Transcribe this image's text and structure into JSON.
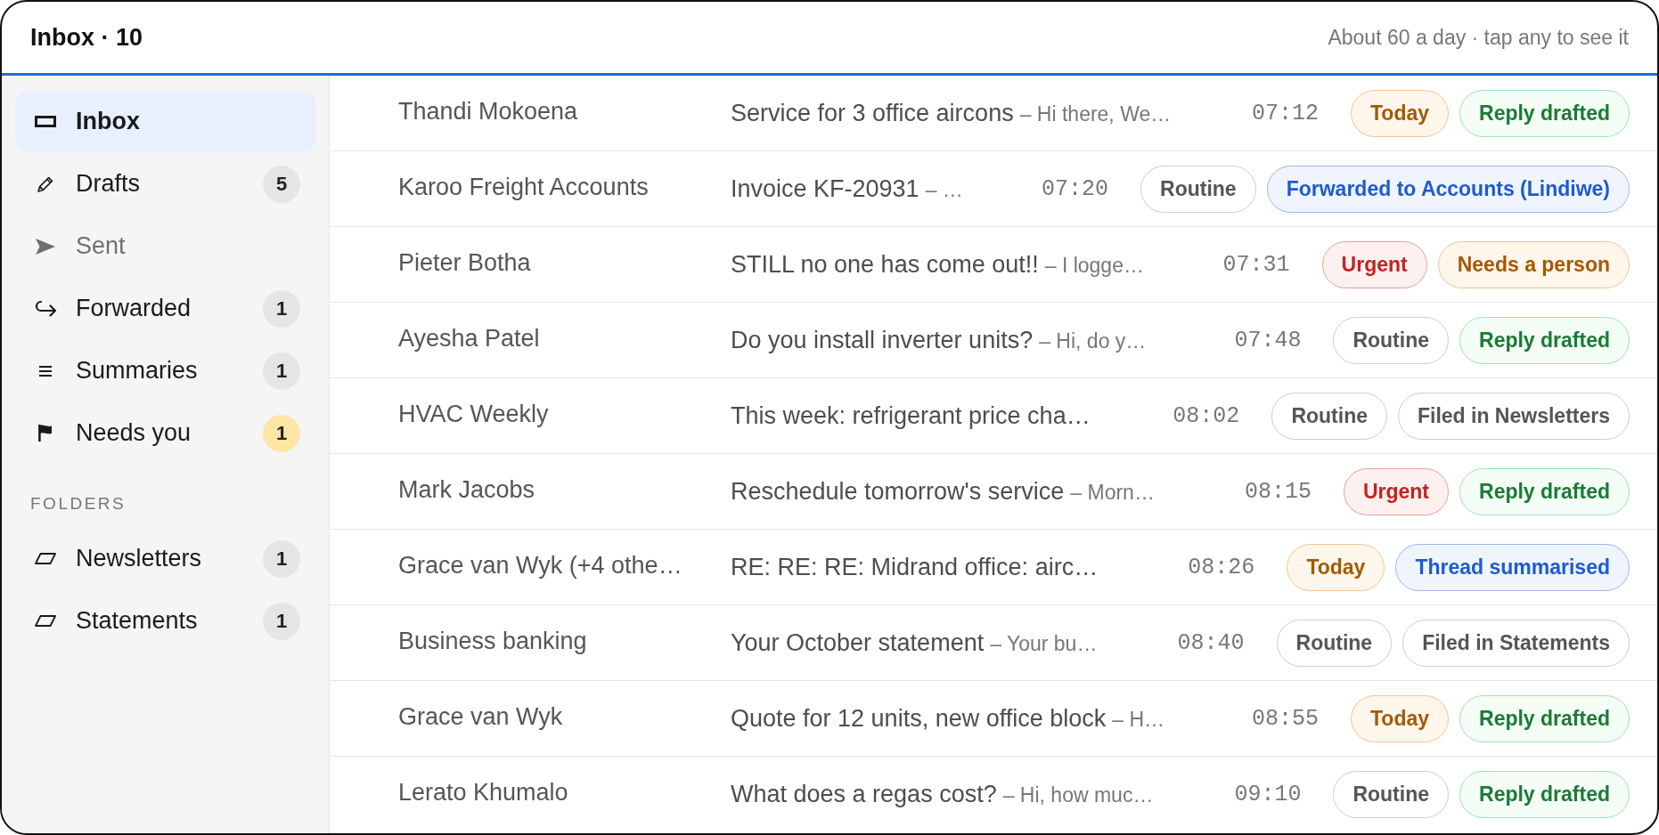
{
  "header": {
    "title": "Inbox · 10",
    "hint": "About 60 a day · tap any to see it"
  },
  "sidebar": {
    "nav": [
      {
        "label": "Inbox",
        "selected": true,
        "dimmed": false
      },
      {
        "label": "Drafts",
        "selected": false,
        "dimmed": false,
        "badge": {
          "count": "5",
          "highlighted": false
        }
      },
      {
        "label": "Sent",
        "selected": false,
        "dimmed": true
      },
      {
        "label": "Forwarded",
        "selected": false,
        "dimmed": false,
        "badge": {
          "count": "1",
          "highlighted": false
        }
      },
      {
        "label": "Summaries",
        "selected": false,
        "dimmed": false,
        "badge": {
          "count": "1",
          "highlighted": false
        }
      },
      {
        "label": "Needs you",
        "selected": false,
        "dimmed": false,
        "badge": {
          "count": "1",
          "highlighted": true
        }
      }
    ],
    "folders": {
      "heading": "FOLDERS",
      "items": [
        {
          "label": "Newsletters",
          "selected": false,
          "dimmed": false,
          "badge": {
            "count": "1",
            "highlighted": false
          }
        },
        {
          "label": "Statements",
          "selected": false,
          "dimmed": false,
          "badge": {
            "count": "1",
            "highlighted": false
          }
        }
      ]
    }
  },
  "messages": [
    {
      "sender": "Thandi Mokoena",
      "subject": "Service for 3 office aircons",
      "preview": "– Hi there, We…",
      "time": "07:12",
      "tags": [
        {
          "label": "Today",
          "color": "#a15a05"
        },
        {
          "label": "Reply drafted",
          "color": "#1b7a35"
        }
      ]
    },
    {
      "sender": "Karoo Freight Accounts",
      "subject": "Invoice KF-20931",
      "preview": "– …",
      "time": "07:20",
      "tags": [
        {
          "label": "Routine",
          "color": "#555555"
        },
        {
          "label": "Forwarded to Accounts (Lindiwe)",
          "color": "#1d5bd0"
        }
      ]
    },
    {
      "sender": "Pieter Botha",
      "subject": "STILL no one has come out!!",
      "preview": "– I logge…",
      "time": "07:31",
      "tags": [
        {
          "label": "Urgent",
          "color": "#c5221f"
        },
        {
          "label": "Needs a person",
          "color": "#a15a05"
        }
      ]
    },
    {
      "sender": "Ayesha Patel",
      "subject": "Do you install inverter units?",
      "preview": "– Hi, do y…",
      "time": "07:48",
      "tags": [
        {
          "label": "Routine",
          "color": "#555555"
        },
        {
          "label": "Reply drafted",
          "color": "#1b7a35"
        }
      ]
    },
    {
      "sender": "HVAC Weekly",
      "subject": "This week: refrigerant price cha…",
      "time": "08:02",
      "tags": [
        {
          "label": "Routine",
          "color": "#555555"
        },
        {
          "label": "Filed in Newsletters",
          "color": "#555555"
        }
      ]
    },
    {
      "sender": "Mark Jacobs",
      "subject": "Reschedule tomorrow's service",
      "preview": "– Morn…",
      "time": "08:15",
      "tags": [
        {
          "label": "Urgent",
          "color": "#c5221f"
        },
        {
          "label": "Reply drafted",
          "color": "#1b7a35"
        }
      ]
    },
    {
      "sender": "Grace van Wyk (+4 othe…",
      "subject": "RE: RE: RE: Midrand office: airc…",
      "time": "08:26",
      "tags": [
        {
          "label": "Today",
          "color": "#a15a05"
        },
        {
          "label": "Thread summarised",
          "color": "#1d5bd0"
        }
      ]
    },
    {
      "sender": "Business banking",
      "subject": "Your October statement",
      "preview": "– Your bu…",
      "time": "08:40",
      "tags": [
        {
          "label": "Routine",
          "color": "#555555"
        },
        {
          "label": "Filed in Statements",
          "color": "#555555"
        }
      ]
    },
    {
      "sender": "Grace van Wyk",
      "subject": "Quote for 12 units, new office block",
      "preview": "– H…",
      "time": "08:55",
      "tags": [
        {
          "label": "Today",
          "color": "#a15a05"
        },
        {
          "label": "Reply drafted",
          "color": "#1b7a35"
        }
      ]
    },
    {
      "sender": "Lerato Khumalo",
      "subject": "What does a regas cost?",
      "preview": "– Hi, how muc…",
      "time": "09:10",
      "tags": [
        {
          "label": "Routine",
          "color": "#555555"
        },
        {
          "label": "Reply drafted",
          "color": "#1b7a35"
        }
      ]
    }
  ]
}
